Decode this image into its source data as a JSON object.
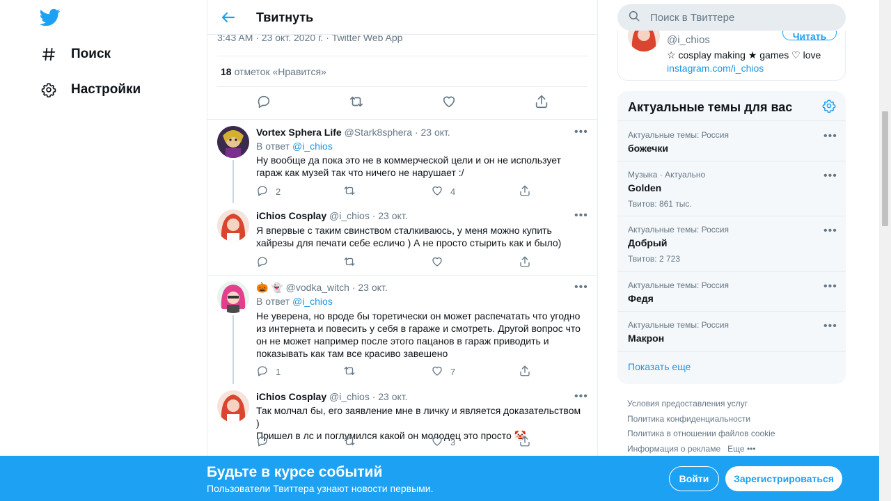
{
  "colors": {
    "accent": "#1da1f2",
    "link": "#1b95e0",
    "muted": "#657786",
    "border": "#e6ecf0"
  },
  "nav": {
    "items": [
      {
        "icon": "hashtag-icon",
        "label": "Поиск"
      },
      {
        "icon": "gear-icon",
        "label": "Настройки"
      }
    ]
  },
  "header": {
    "title": "Твитнуть"
  },
  "main_tweet": {
    "meta": "3:43 AM · 23 окт. 2020 г. · Twitter Web App",
    "likes_count": "18",
    "likes_label": "отметок «Нравится»"
  },
  "replies": [
    {
      "name": "Vortex Sphera Life",
      "handle": "@Stark8sphera",
      "date": "· 23 окт.",
      "reply_prefix": "В ответ",
      "reply_to": "@i_chios",
      "lines": [
        "Ну вообще да пока это не в коммерческой цели и он не использует",
        "гараж как музей так что ничего не нарушает :/"
      ],
      "replies": "2",
      "retweets": "",
      "likes": "4"
    },
    {
      "name": "iChios Cosplay",
      "handle": "@i_chios",
      "date": "· 23 окт.",
      "lines": [
        "Я впервые с таким свинством сталкиваюсь, у меня можно купить",
        "хайрезы для печати себе есличо ) А не просто стырить как и было)"
      ],
      "replies": "",
      "retweets": "",
      "likes": ""
    },
    {
      "name": "🎃 👻",
      "handle": "@vodka_witch",
      "date": "· 23 окт.",
      "reply_prefix": "В ответ",
      "reply_to": "@i_chios",
      "lines": [
        "Не уверена, но вроде бы торетически он может распечатать что угодно",
        "из интернета и повесить у себя в гараже и смотреть. Другой вопрос что",
        "он не может например после этого пацанов в гараж приводить и",
        "показывать как там все красиво завешено"
      ],
      "replies": "1",
      "retweets": "",
      "likes": "7"
    },
    {
      "name": "iChios Cosplay",
      "handle": "@i_chios",
      "date": "· 23 окт.",
      "lines": [
        "Так молчал бы, его заявление мне в личку и является доказательством )",
        "Пришел в лс и поглумился какой он молодец это просто 🤡"
      ],
      "replies": "",
      "retweets": "",
      "likes": "3"
    }
  ],
  "search": {
    "placeholder": "Поиск в Твиттере"
  },
  "profile_card": {
    "handle": "@i_chios",
    "follow_label": "Читать",
    "bio": "☆ cosplay making ★ games ♡ love",
    "link": "instagram.com/i_chios"
  },
  "trends": {
    "title": "Актуальные темы для вас",
    "items": [
      {
        "context": "Актуальные темы: Россия",
        "title": "божечки",
        "count": ""
      },
      {
        "context": "Музыка · Актуально",
        "title": "Golden",
        "count": "Твитов: 861 тыс."
      },
      {
        "context": "Актуальные темы: Россия",
        "title": "Добрый",
        "count": "Твитов: 2 723"
      },
      {
        "context": "Актуальные темы: Россия",
        "title": "Федя",
        "count": ""
      },
      {
        "context": "Актуальные темы: Россия",
        "title": "Макрон",
        "count": ""
      }
    ],
    "show_more": "Показать еще"
  },
  "footer": {
    "links": [
      "Условия предоставления услуг",
      "Политика конфиденциальности",
      "Политика в отношении файлов cookie",
      "Информация о рекламе",
      "Еще"
    ]
  },
  "banner": {
    "title": "Будьте в курсе событий",
    "subtitle": "Пользователи Твиттера узнают новости первыми.",
    "login_label": "Войти",
    "signup_label": "Зарегистрироваться"
  }
}
